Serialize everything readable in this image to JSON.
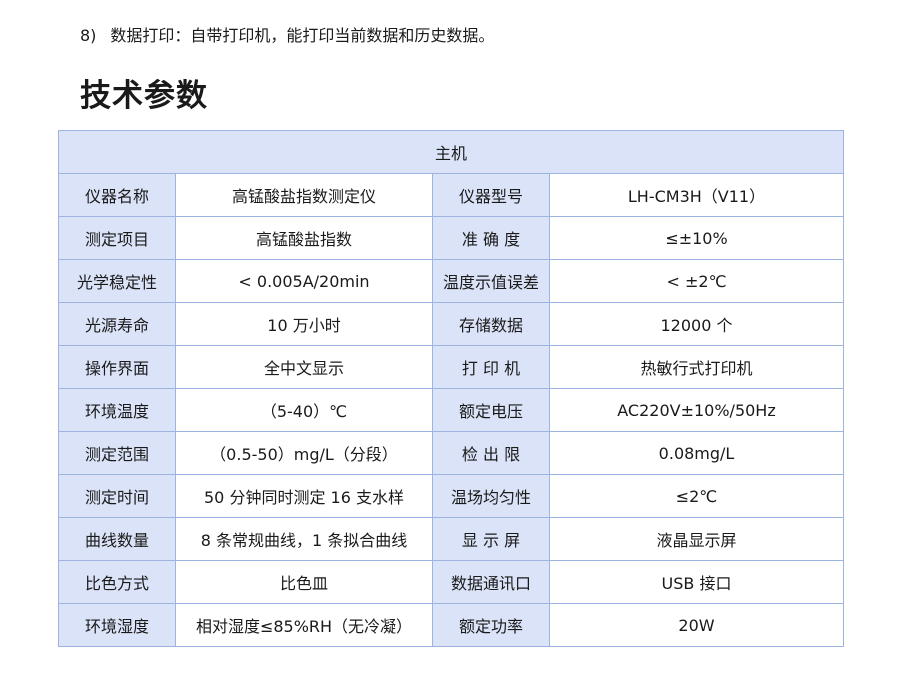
{
  "intro": {
    "number": "8)",
    "text": "数据打印：自带打印机，能打印当前数据和历史数据。"
  },
  "section_title": "技术参数",
  "table": {
    "header": "主机",
    "rows": [
      {
        "label1": "仪器名称",
        "value1": "高锰酸盐指数测定仪",
        "label2": "仪器型号",
        "value2": "LH-CM3H（V11）"
      },
      {
        "label1": "测定项目",
        "value1": "高锰酸盐指数",
        "label2": "准 确 度",
        "value2": "≤±10%"
      },
      {
        "label1": "光学稳定性",
        "value1": "< 0.005A/20min",
        "label2": "温度示值误差",
        "value2": "< ±2℃"
      },
      {
        "label1": "光源寿命",
        "value1": "10 万小时",
        "label2": "存储数据",
        "value2": "12000 个"
      },
      {
        "label1": "操作界面",
        "value1": "全中文显示",
        "label2": "打 印 机",
        "value2": "热敏行式打印机"
      },
      {
        "label1": "环境温度",
        "value1": "（5-40）℃",
        "label2": "额定电压",
        "value2": "AC220V±10%/50Hz"
      },
      {
        "label1": "测定范围",
        "value1": "（0.5-50）mg/L（分段）",
        "label2": "检 出 限",
        "value2": "0.08mg/L"
      },
      {
        "label1": "测定时间",
        "value1": "50 分钟同时测定 16 支水样",
        "label2": "温场均匀性",
        "value2": "≤2℃"
      },
      {
        "label1": "曲线数量",
        "value1": "8 条常规曲线，1 条拟合曲线",
        "label2": "显 示 屏",
        "value2": "液晶显示屏"
      },
      {
        "label1": "比色方式",
        "value1": "比色皿",
        "label2": "数据通讯口",
        "value2": "USB 接口"
      },
      {
        "label1": "环境湿度",
        "value1": "相对湿度≤85%RH（无冷凝）",
        "label2": "额定功率",
        "value2": "20W"
      }
    ]
  },
  "colors": {
    "label_bg": "#dae3f7",
    "border": "#9db3e0",
    "text": "#1a1a1a"
  }
}
